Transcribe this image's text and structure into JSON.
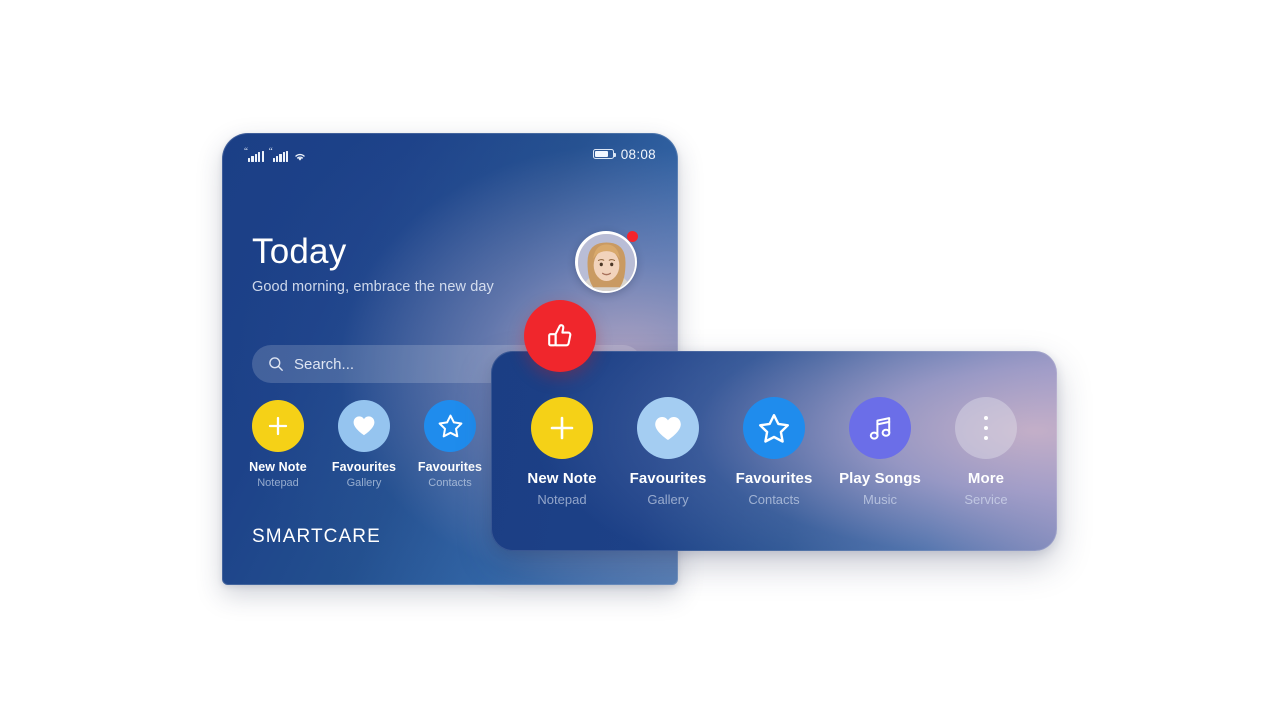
{
  "canvas": {
    "background": "#ffffff"
  },
  "phone": {
    "status_bar": {
      "signal_icon_1": "signal-bars-icon",
      "signal_icon_2": "signal-bars-icon",
      "wifi_icon": "wifi-icon",
      "battery_icon": "battery-icon",
      "time": "08:08"
    },
    "greeting": {
      "title": "Today",
      "subtitle": "Good morning, embrace the new day"
    },
    "avatar": {
      "icon": "user-avatar",
      "badge": "notification-dot"
    },
    "search": {
      "icon": "search-icon",
      "placeholder": "Search..."
    },
    "tiles": [
      {
        "icon": "plus-icon",
        "label": "New Note",
        "sub": "Notepad",
        "circle_color": "#f5d117",
        "icon_color": "#ffffff"
      },
      {
        "icon": "heart-icon",
        "label": "Favourites",
        "sub": "Gallery",
        "circle_color": "#95c4ef",
        "icon_color": "#ffffff"
      },
      {
        "icon": "star-icon",
        "label": "Favourites",
        "sub": "Contacts",
        "circle_color": "#1f8ced",
        "icon_color": "#ffffff"
      }
    ],
    "footer_label": "SMARTCARE"
  },
  "card": {
    "tiles": [
      {
        "icon": "plus-icon",
        "label": "New Note",
        "sub": "Notepad",
        "circle_color": "#f5d117",
        "icon_color": "#ffffff"
      },
      {
        "icon": "heart-icon",
        "label": "Favourites",
        "sub": "Gallery",
        "circle_color": "#a4cdf2",
        "icon_color": "#ffffff"
      },
      {
        "icon": "star-icon",
        "label": "Favourites",
        "sub": "Contacts",
        "circle_color": "#1f8ced",
        "icon_color": "#ffffff"
      },
      {
        "icon": "music-note-icon",
        "label": "Play Songs",
        "sub": "Music",
        "circle_color": "#6b6ee8",
        "icon_color": "#ffffff"
      },
      {
        "icon": "more-dots-icon",
        "label": "More",
        "sub": "Service",
        "circle_color": "rgba(226,226,236,0.42)",
        "icon_color": "#ffffff"
      }
    ]
  },
  "badge": {
    "icon": "thumbs-up-icon",
    "color": "#f0262c"
  }
}
